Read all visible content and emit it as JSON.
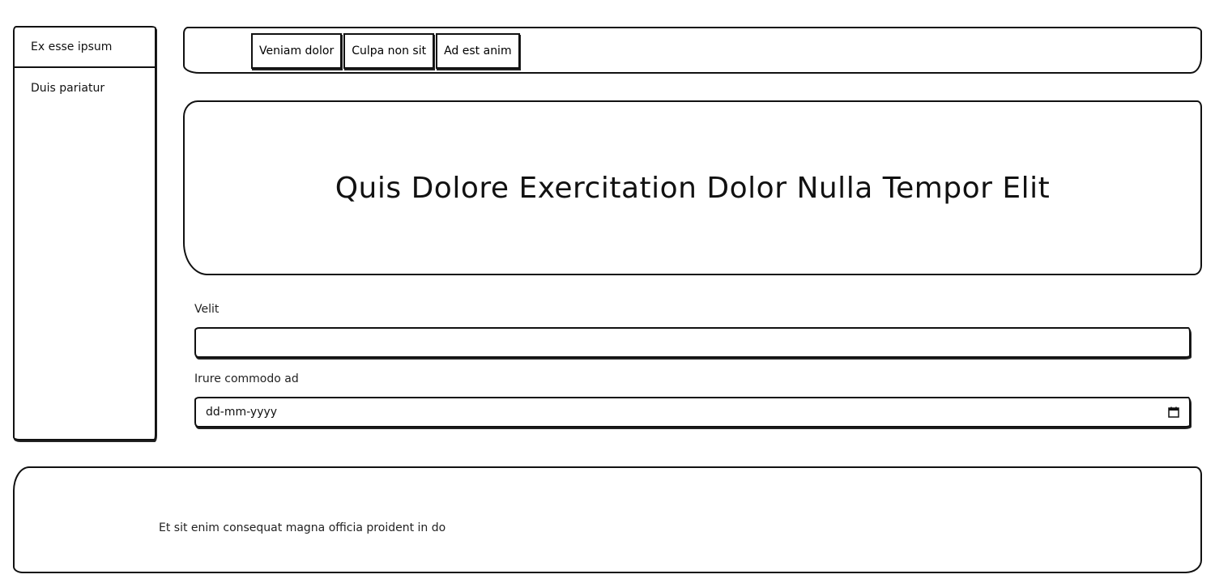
{
  "sidebar": {
    "items": [
      {
        "label": "Ex esse ipsum"
      },
      {
        "label": "Duis pariatur"
      }
    ]
  },
  "nav": {
    "buttons": [
      {
        "label": "Veniam dolor"
      },
      {
        "label": "Culpa non sit"
      },
      {
        "label": "Ad est anim"
      }
    ]
  },
  "hero": {
    "title": "Quis Dolore Exercitation Dolor Nulla Tempor Elit"
  },
  "form": {
    "velit": {
      "label": "Velit",
      "value": ""
    },
    "irure": {
      "label": "Irure commodo ad",
      "value": "dd-mm-yyyy",
      "icon": "calendar-icon"
    }
  },
  "footer": {
    "text": "Et sit enim consequat magna officia proident in do"
  }
}
